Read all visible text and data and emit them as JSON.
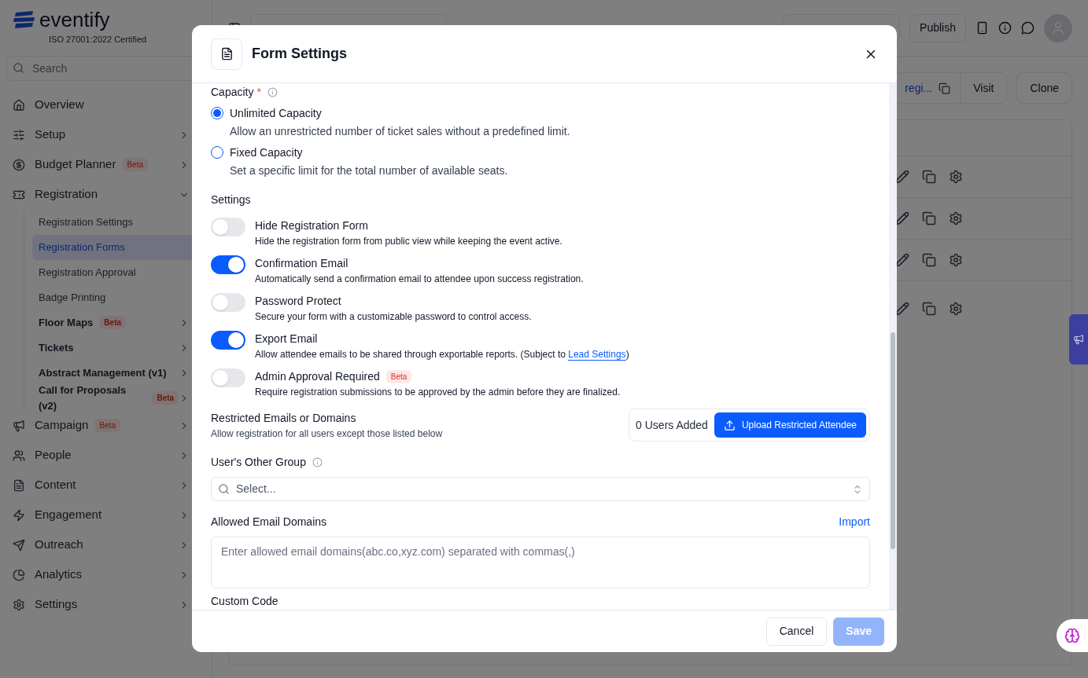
{
  "brand": {
    "name": "eventify",
    "certification": "ISO 27001:2022 Certified"
  },
  "sidebar": {
    "search": {
      "placeholder": "Search"
    },
    "items": [
      {
        "label": "Overview"
      },
      {
        "label": "Setup",
        "expanded": false
      },
      {
        "label": "Budget Planner",
        "badge": "Beta",
        "expanded": false
      },
      {
        "label": "Registration",
        "expanded": true,
        "children": [
          {
            "label": "Registration Settings",
            "selected": false
          },
          {
            "label": "Registration Forms",
            "selected": true
          },
          {
            "label": "Registration Approval",
            "selected": false
          },
          {
            "label": "Badge Printing",
            "selected": false
          },
          {
            "label": "Floor Maps",
            "badge": "Beta",
            "selected": false,
            "expanded": false
          },
          {
            "label": "Tickets",
            "selected": false,
            "expanded": false
          },
          {
            "label": "Abstract Management (v1)",
            "selected": false,
            "expanded": false
          },
          {
            "label": "Call for Proposals (v2)",
            "badge": "Beta",
            "selected": false,
            "expanded": false
          }
        ]
      },
      {
        "label": "Campaign",
        "badge": "Beta",
        "expanded": false
      },
      {
        "label": "People",
        "expanded": false
      },
      {
        "label": "Content",
        "expanded": false
      },
      {
        "label": "Engagement",
        "expanded": false
      },
      {
        "label": "Outreach",
        "expanded": false
      },
      {
        "label": "Analytics",
        "expanded": false
      },
      {
        "label": "Settings",
        "expanded": false
      }
    ]
  },
  "topbar": {
    "publish": "Publish"
  },
  "page": {
    "link": "regi...",
    "buttons": [
      "Visit",
      "Clone"
    ]
  },
  "modal": {
    "title": "Form Settings",
    "capacity": {
      "label": "Capacity",
      "required_mark": "*",
      "options": [
        {
          "label": "Unlimited Capacity",
          "description": "Allow an unrestricted number of ticket sales without a predefined limit.",
          "selected": true
        },
        {
          "label": "Fixed Capacity",
          "description": "Set a specific limit for the total number of available seats.",
          "selected": false
        }
      ]
    },
    "settings": {
      "heading": "Settings",
      "toggles": [
        {
          "label": "Hide Registration Form",
          "description": "Hide the registration form from public view while keeping the event active.",
          "on": false
        },
        {
          "label": "Confirmation Email",
          "description": "Automatically send a confirmation email to attendee upon success registration.",
          "on": true
        },
        {
          "label": "Password Protect",
          "description": "Secure your form with a customizable password to control access.",
          "on": false
        },
        {
          "label": "Export Email",
          "description": "Allow attendee emails to be shared through exportable reports. (Subject to ",
          "link": "Lead Settings",
          "description_end": ")",
          "on": true
        },
        {
          "label": "Admin Approval Required",
          "badge": "Beta",
          "description": "Require registration submissions to be approved by the admin before they are finalized.",
          "on": false
        }
      ]
    },
    "restricted": {
      "title": "Restricted Emails or Domains",
      "subtitle": "Allow registration for all users except those listed below",
      "count": "0 Users Added",
      "button": "Upload Restricted Attendee"
    },
    "other_group": {
      "label": "User's Other Group",
      "placeholder": "Select..."
    },
    "allowed_domains": {
      "label": "Allowed Email Domains",
      "link": "Import",
      "placeholder": "Enter allowed email domains(abc.co,xyz.com) separated with commas(,)"
    },
    "custom_code": {
      "heading": "Custom Code"
    },
    "footer": {
      "cancel": "Cancel",
      "save": {
        "label": "Save",
        "disabled": true
      }
    }
  }
}
